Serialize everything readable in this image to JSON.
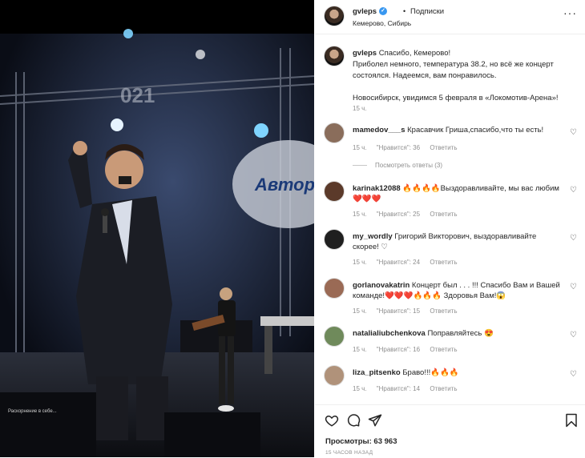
{
  "post": {
    "username": "gvleps",
    "follow_label": "Подписки",
    "dot": "•",
    "location": "Кемерово, Сибирь",
    "more_icon": "more-icon"
  },
  "caption": {
    "username": "gvleps",
    "text": "Спасибо, Кемерово!\nПриболел немного, температура 38.2, но всё же концерт состоялся. Надеемся, вам понравилось.\n\nНовосибирск, увидимся 5 февраля в «Локомотив-Арена»!",
    "time": "15 ч."
  },
  "comments": [
    {
      "username": "mamedov___s",
      "text": "Красавчик Гриша,спасибо,что ты есть!",
      "time": "15 ч.",
      "likes": "\"Нравится\": 36",
      "reply": "Ответить",
      "avatar_color": "#8a6d5b"
    },
    {
      "username": "karinak12088",
      "text": "🔥🔥🔥🔥Выздоравливайте, мы вас любим ❤️❤️❤️",
      "time": "15 ч.",
      "likes": "\"Нравится\": 25",
      "reply": "Ответить",
      "avatar_color": "#5b3a2a"
    },
    {
      "username": "my_wordly",
      "text": "Григорий Викторович, выздоравливайте скорее! ♡",
      "time": "15 ч.",
      "likes": "\"Нравится\": 24",
      "reply": "Ответить",
      "avatar_color": "#1f1f1f"
    },
    {
      "username": "gorlanovakatrin",
      "text": "Концерт был . . . !!! Спасибо Вам и Вашей команде!❤️❤️❤️🔥🔥🔥 Здоровья Вам!😱",
      "time": "15 ч.",
      "likes": "\"Нравится\": 15",
      "reply": "Ответить",
      "avatar_color": "#9a6a55"
    },
    {
      "username": "natalialiubchenkova",
      "text": "Поправляйтесь 😍",
      "time": "15 ч.",
      "likes": "\"Нравится\": 16",
      "reply": "Ответить",
      "avatar_color": "#6f8a5b"
    },
    {
      "username": "liza_pitsenko",
      "text": "Браво!!!🔥🔥🔥",
      "time": "15 ч.",
      "likes": "\"Нравится\": 14",
      "reply": "Ответить",
      "avatar_color": "#b0927a"
    }
  ],
  "view_replies": "Посмотреть ответы (3)",
  "footer": {
    "views_label": "Просмотры: 63 963",
    "time_ago": "15 ЧАСОВ НАЗАД",
    "icons": [
      "heart-icon",
      "comment-icon",
      "share-icon",
      "bookmark-icon"
    ]
  },
  "colors": {
    "verified": "#3897f0",
    "secondary": "#8e8e8e"
  }
}
